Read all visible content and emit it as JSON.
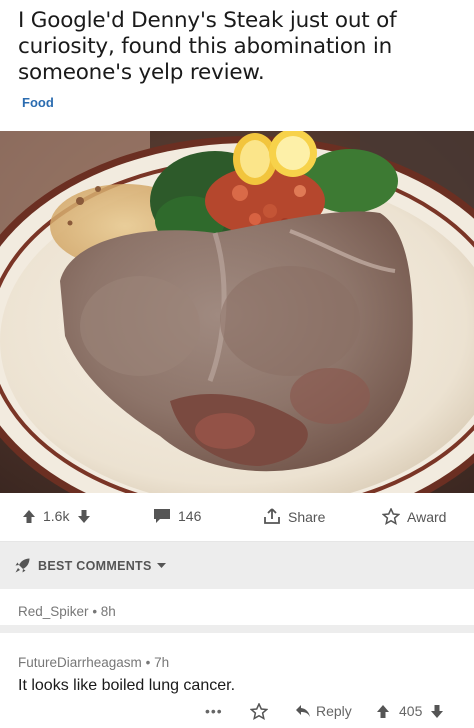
{
  "post": {
    "title": "I Google'd Denny's Steak just out of curiosity, found this abomination in someone's yelp review.",
    "flair": "Food"
  },
  "image": {
    "description_icon": "steak-photo"
  },
  "actions": {
    "votes": "1.6k",
    "comments": "146",
    "share": "Share",
    "award": "Award"
  },
  "sort": {
    "label": "BEST COMMENTS"
  },
  "comments": [
    {
      "author": "Red_Spiker",
      "age": "8h"
    },
    {
      "author": "FutureDiarrheagasm",
      "age": "7h",
      "body": "It looks like boiled lung cancer.",
      "more": "•••",
      "reply": "Reply",
      "score": "405"
    }
  ],
  "colors": {
    "flair": "#2b6cb0",
    "divider": "#ededed",
    "icon": "#555555"
  }
}
